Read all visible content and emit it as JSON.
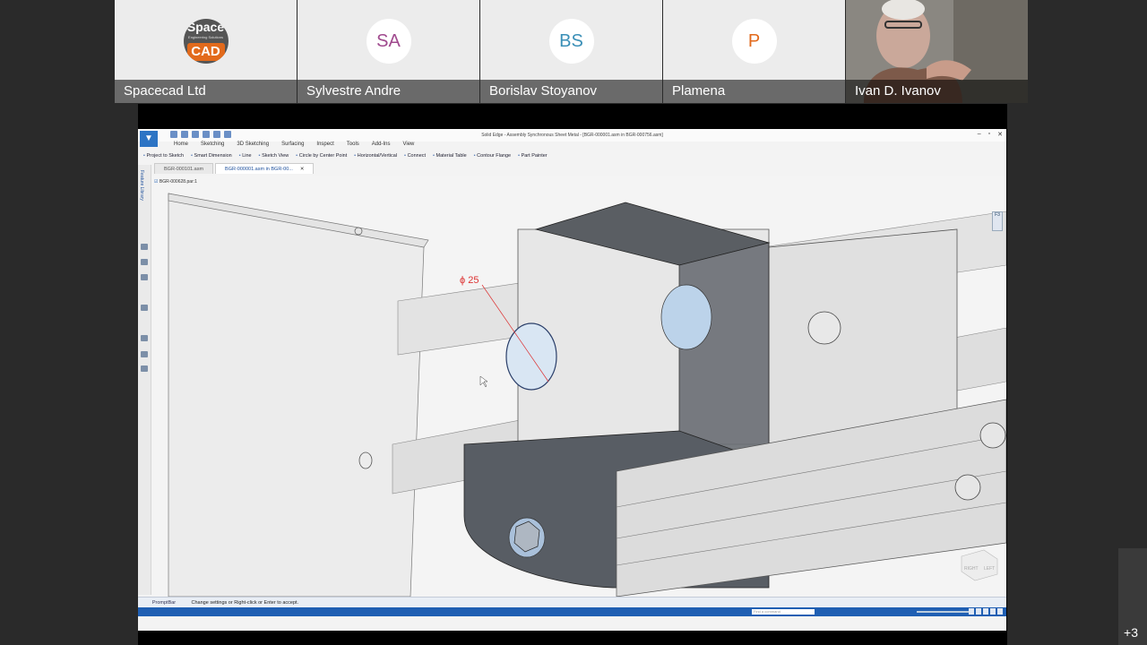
{
  "participants": [
    {
      "name": "Spacecad Ltd",
      "type": "logo",
      "logo_top": "Space",
      "logo_sub": "Engineering Solutions",
      "logo_bottom": "CAD"
    },
    {
      "name": "Sylvestre Andre",
      "type": "initials",
      "initials": "SA",
      "color": "#a04a8e"
    },
    {
      "name": "Borislav Stoyanov",
      "type": "initials",
      "initials": "BS",
      "color": "#3a8fb7"
    },
    {
      "name": "Plamena",
      "type": "initials",
      "initials": "P",
      "color": "#e26a1c"
    },
    {
      "name": "Ivan D. Ivanov",
      "type": "video"
    }
  ],
  "overflow_count": "+3",
  "app": {
    "title": "Solid Edge - Assembly Synchronous Sheet Metal - [BGR-000001.asm in BGR-000756.asm]",
    "ribbon_tabs": [
      "Home",
      "Sketching",
      "3D Sketching",
      "Surfacing",
      "Inspect",
      "Tools",
      "Add-Ins",
      "View"
    ],
    "commands": [
      "Project to Sketch",
      "Smart Dimension",
      "Line",
      "Sketch View",
      "Circle by Center Point",
      "Horizontal/Vertical",
      "Connect",
      "Material Table",
      "Contour Flange",
      "Part Painter"
    ],
    "doc_tabs": [
      {
        "label": "BGR-000101.asm",
        "active": false
      },
      {
        "label": "BGR-000001.asm in BGR-00...",
        "active": true
      }
    ],
    "side_label": "Feature Library",
    "tree_item": "BGR-000628.par:1",
    "dimension_label": "ϕ 25",
    "prompt_label": "PromptBar",
    "prompt_text": "Change settings or Right-click or Enter to accept.",
    "search_placeholder": "Find a command",
    "view_cube_top": "RIGHT",
    "view_cube_side": "LEFT",
    "accent_color": "#1f5fb3"
  }
}
